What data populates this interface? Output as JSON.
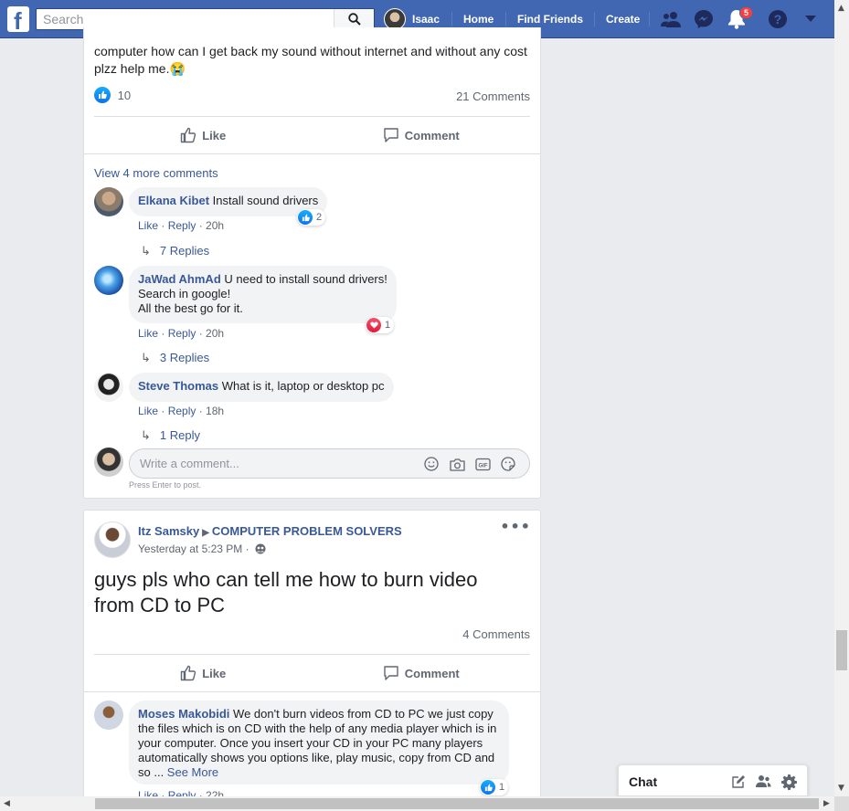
{
  "topbar": {
    "search_placeholder": "Search",
    "profile_name": "Isaac",
    "home": "Home",
    "find_friends": "Find Friends",
    "create": "Create",
    "notification_count": "5"
  },
  "post1": {
    "text_line1": "computer how can I get back my sound without internet and without any cost",
    "text_line2": "plzz help me.😭",
    "like_count": "10",
    "comments_count": "21 Comments",
    "like_label": "Like",
    "comment_label": "Comment",
    "view_more": "View 4 more comments",
    "comments": [
      {
        "author": "Elkana Kibet",
        "text": "Install sound drivers",
        "like": "Like",
        "reply": "Reply",
        "time": "20h",
        "reaction_count": "2",
        "replies": "7 Replies"
      },
      {
        "author": "JaWad AhmAd",
        "text_lines": [
          "U need to install sound drivers!",
          "Search in google!",
          "All the best go for it."
        ],
        "like": "Like",
        "reply": "Reply",
        "time": "20h",
        "reaction_count": "1",
        "replies": "3 Replies"
      },
      {
        "author": "Steve Thomas",
        "text": "What is it, laptop or desktop pc",
        "like": "Like",
        "reply": "Reply",
        "time": "18h",
        "replies": "1 Reply"
      }
    ],
    "write_placeholder": "Write a comment...",
    "press_enter": "Press Enter to post."
  },
  "post2": {
    "author": "Itz Samsky",
    "group": "COMPUTER PROBLEM SOLVERS",
    "timestamp": "Yesterday at 5:23 PM ·",
    "text_line1": "guys pls who can tell me how to burn video",
    "text_line2": "from CD to PC",
    "comments_count": "4 Comments",
    "like_label": "Like",
    "comment_label": "Comment",
    "comment": {
      "author": "Moses Makobidi",
      "text_line1": "We don't burn videos from CD to PC we just copy",
      "text_line2": "the files which is on CD with the help of any media player which is in",
      "text_line3": "your computer. Once you insert your CD in your PC many players",
      "text_line4": "automatically shows you options like, play music, copy from CD and",
      "text_line5": "so ... ",
      "see_more": "See More",
      "reaction_count": "1",
      "like": "Like",
      "reply": "Reply",
      "time": "22h"
    }
  },
  "chat": {
    "label": "Chat"
  },
  "colors": {
    "brand": "#4267b2",
    "link": "#385898",
    "background": "#e9ebee",
    "badge": "#fa3e3e"
  }
}
